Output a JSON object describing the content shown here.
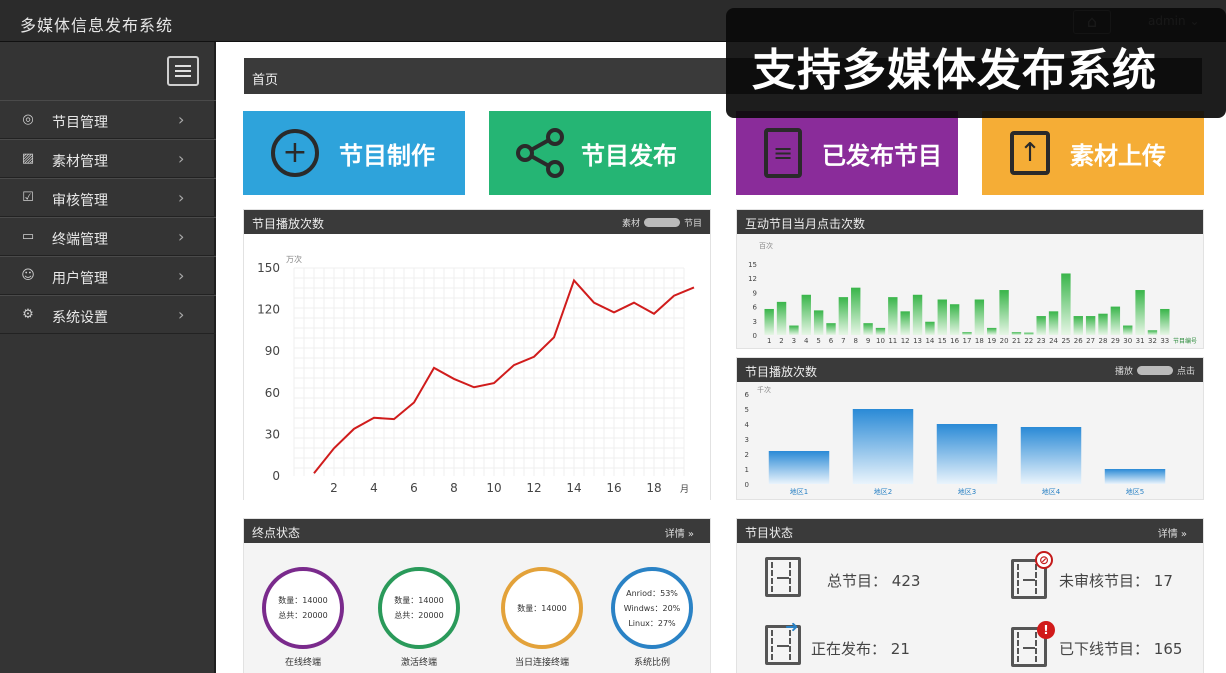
{
  "app": {
    "title": "多媒体信息发布系统",
    "user": "admin"
  },
  "banner": {
    "text": "支持多媒体发布系统"
  },
  "sidebar": {
    "items": [
      {
        "label": "节目管理",
        "icon": "play-circle-icon"
      },
      {
        "label": "素材管理",
        "icon": "image-icon"
      },
      {
        "label": "审核管理",
        "icon": "checkbox-icon"
      },
      {
        "label": "终端管理",
        "icon": "monitor-icon"
      },
      {
        "label": "用户管理",
        "icon": "user-circle-icon"
      },
      {
        "label": "系统设置",
        "icon": "gear-icon"
      }
    ]
  },
  "breadcrumb": {
    "label": "首页"
  },
  "tiles": [
    {
      "label": "节目制作",
      "icon": "plus-circle-icon"
    },
    {
      "label": "节目发布",
      "icon": "share-icon"
    },
    {
      "label": "已发布节目",
      "icon": "document-icon"
    },
    {
      "label": "素材上传",
      "icon": "upload-icon"
    }
  ],
  "panels": {
    "playcount": {
      "title": "节目播放次数",
      "toggle_left": "素材",
      "toggle_right": "节目"
    },
    "interactive": {
      "title": "互动节目当月点击次数"
    },
    "region": {
      "title": "节目播放次数",
      "toggle_left": "播放",
      "toggle_right": "点击"
    },
    "terminal_status": {
      "title": "终点状态",
      "detail": "详情",
      "rings": [
        {
          "line1": "数量：14000",
          "line2": "总共：20000",
          "label": "在线终端",
          "color": "#7a2a8c"
        },
        {
          "line1": "数量：14000",
          "line2": "总共：20000",
          "label": "激活终端",
          "color": "#2a9a5a"
        },
        {
          "line1": "数量：14000",
          "line2": "",
          "label": "当日连接终端",
          "color": "#e3a23a"
        },
        {
          "line1": "Anriod：53%",
          "line2": "Windws：20%",
          "line3": "Linux：27%",
          "label": "系统比例",
          "color": "#2a82c5"
        }
      ]
    },
    "program_status": {
      "title": "节目状态",
      "detail": "详情",
      "stats": [
        {
          "label": "总节目：",
          "value": "423"
        },
        {
          "label": "未审核节目：",
          "value": "17"
        },
        {
          "label": "正在发布：",
          "value": "21"
        },
        {
          "label": "已下线节目：",
          "value": "165"
        }
      ]
    }
  },
  "chart_data": [
    {
      "type": "line",
      "title": "节目播放次数",
      "unit": "万次",
      "x": [
        1,
        2,
        3,
        4,
        5,
        6,
        7,
        8,
        9,
        10,
        11,
        12,
        13,
        14,
        15,
        16,
        17,
        18,
        19,
        20
      ],
      "y": [
        2,
        20,
        34,
        42,
        41,
        53,
        78,
        70,
        64,
        67,
        80,
        86,
        100,
        141,
        125,
        118,
        125,
        117,
        130,
        136
      ],
      "xticks": [
        2,
        4,
        6,
        8,
        10,
        12,
        14,
        16,
        18
      ],
      "xunit": "月",
      "yticks": [
        0,
        30,
        60,
        90,
        120,
        150
      ],
      "xlim": [
        0,
        19.5
      ],
      "ylim": [
        0,
        150
      ],
      "color": "#d01c1c",
      "grid": true
    },
    {
      "type": "bar",
      "title": "互动节目当月点击次数",
      "unit": "百次",
      "categories": [
        "1",
        "2",
        "3",
        "4",
        "5",
        "6",
        "7",
        "8",
        "9",
        "10",
        "11",
        "12",
        "13",
        "14",
        "15",
        "16",
        "17",
        "18",
        "19",
        "20",
        "21",
        "22",
        "23",
        "24",
        "25",
        "26",
        "27",
        "28",
        "29",
        "30",
        "31",
        "32",
        "33"
      ],
      "values": [
        5.5,
        7,
        2,
        8.5,
        5.2,
        2.5,
        8,
        10,
        2.5,
        1.5,
        8,
        5,
        8.5,
        2.8,
        7.5,
        6.5,
        0.6,
        7.5,
        1.5,
        9.5,
        0.6,
        0.5,
        4,
        5,
        13,
        4,
        4,
        4.5,
        6,
        2,
        9.5,
        1,
        5.5
      ],
      "xunit": "节目编号",
      "yticks": [
        0,
        3,
        6,
        9,
        12,
        15
      ],
      "ylim": [
        0,
        15
      ],
      "color": "#39b54a"
    },
    {
      "type": "bar",
      "title": "节目播放次数",
      "unit": "千次",
      "categories": [
        "地区1",
        "地区2",
        "地区3",
        "地区4",
        "地区5"
      ],
      "values": [
        2.2,
        5,
        4,
        3.8,
        1
      ],
      "yticks": [
        0,
        1,
        2,
        3,
        4,
        5,
        6
      ],
      "ylim": [
        0,
        6
      ],
      "color": "#2a8ad6"
    }
  ]
}
